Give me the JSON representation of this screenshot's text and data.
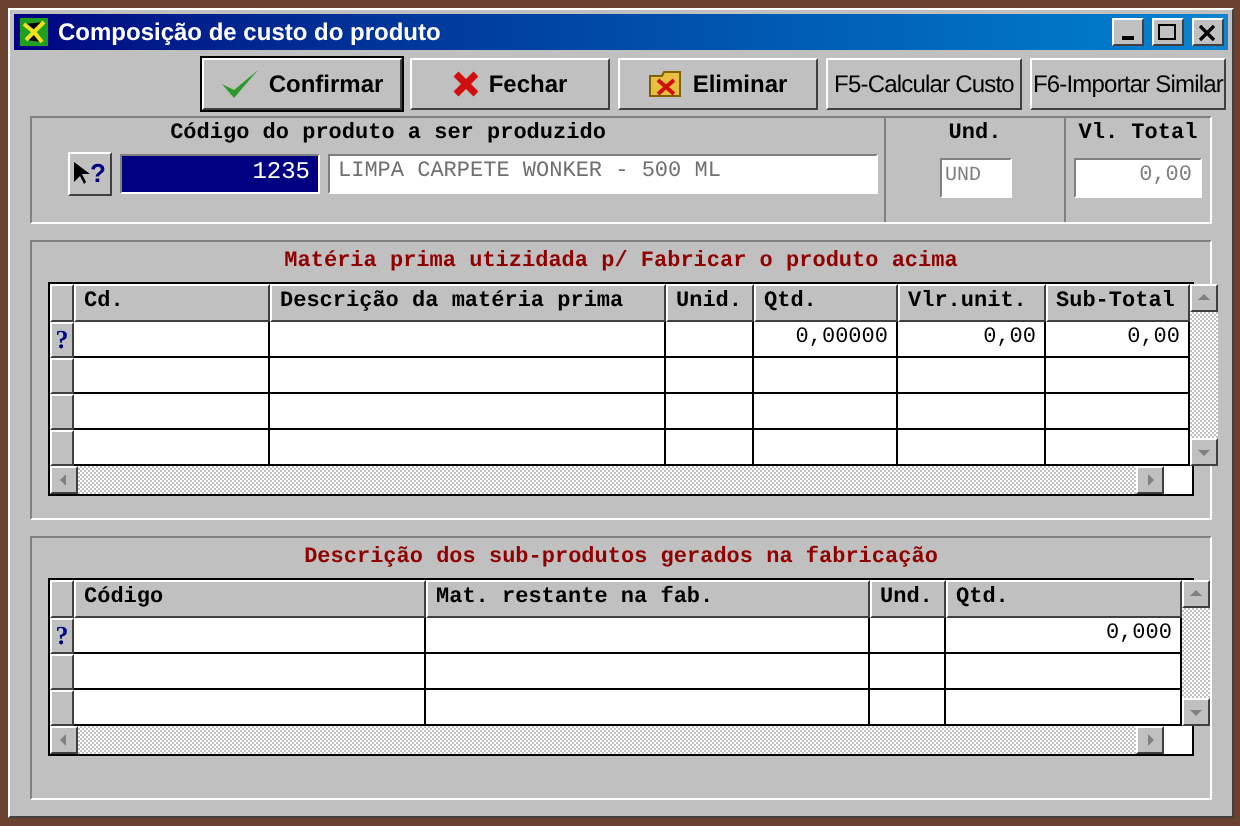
{
  "window": {
    "title": "Composição de custo do produto"
  },
  "toolbar": [
    {
      "label": "Confirmar",
      "kind": "check",
      "selected": true
    },
    {
      "label": "Fechar",
      "kind": "close"
    },
    {
      "label": "Eliminar",
      "kind": "delete"
    },
    {
      "label": "F5-Calcular Custo",
      "kind": "plain"
    },
    {
      "label": "F6-Importar Similar",
      "kind": "plain"
    }
  ],
  "product": {
    "code_label": "Código do produto a ser produzido",
    "unit_label": "Und.",
    "total_label": "Vl. Total",
    "help_button": "?",
    "code": "1235",
    "description": "LIMPA CARPETE WONKER - 500 ML",
    "unit": "UND",
    "total": "0,00"
  },
  "materials": {
    "title": "Matéria prima utizidada p/ Fabricar o produto acima",
    "row_marker": "?",
    "columns": [
      {
        "label": "Cd."
      },
      {
        "label": "Descrição da matéria prima"
      },
      {
        "label": "Unid."
      },
      {
        "label": "Qtd.",
        "value": "0,00000"
      },
      {
        "label": "Vlr.unit.",
        "value": "0,00"
      },
      {
        "label": "Sub-Total",
        "value": "0,00"
      }
    ]
  },
  "byproducts": {
    "title": "Descrição dos sub-produtos gerados na fabricação",
    "row_marker": "?",
    "columns": [
      {
        "label": "Código"
      },
      {
        "label": "Mat. restante na fab."
      },
      {
        "label": "Und."
      },
      {
        "label": "Qtd.",
        "value": "0,000"
      }
    ]
  }
}
